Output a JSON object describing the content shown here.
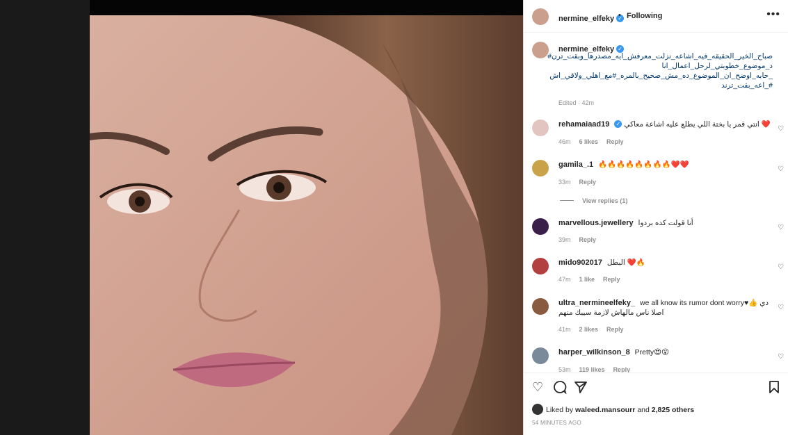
{
  "post": {
    "username": "nermine_elfeky",
    "separator": "•",
    "following_label": "Following",
    "more_label": "•••",
    "caption": "صباح_الخير_الحقيقه_فيه_اشاعه_نزلت_معرفش_ايه_مصدرها_وبقت_ترن#\nد_موضوع_خطوبتي_لرحل_اعمال_انا\n_حابه_اوضح_ان_الموضوع_ده_مش_صحيح_بالمره_#مع_اهلي_ولاقي_اش\n#_اعه_بقت_ترند",
    "caption_meta": "Edited · 42m"
  },
  "comments": [
    {
      "username": "rehamaiaad19",
      "verified": true,
      "text": "انتي قمر يا بختة اللي يطلع عليه اشاعة معاكي ❤️",
      "time": "46m",
      "likes": "6 likes",
      "reply": "Reply"
    },
    {
      "username": "gamila_.1",
      "verified": false,
      "text": "🔥🔥🔥🔥🔥🔥🔥🔥❤️❤️",
      "time": "33m",
      "likes": "",
      "reply": "Reply"
    },
    {
      "username": "marvellous.jewellery",
      "verified": false,
      "text": "أنا قولت كده بردوا",
      "time": "39m",
      "likes": "",
      "reply": "Reply"
    },
    {
      "username": "mido902017",
      "verified": false,
      "text": "البطل ❤️🔥",
      "time": "47m",
      "likes": "1 like",
      "reply": "Reply"
    },
    {
      "username": "ultra_nermineelfeky_",
      "verified": false,
      "text": "we all know its rumor dont worry♥👍 دي\nاصلا ناس مالهاش لازمة سيبك منهم",
      "time": "41m",
      "likes": "2 likes",
      "reply": "Reply"
    },
    {
      "username": "harper_wilkinson_8",
      "verified": false,
      "text": "Pretty😍😮",
      "time": "53m",
      "likes": "119 likes",
      "reply": "Reply"
    }
  ],
  "view_replies": "View replies (1)",
  "likes": {
    "prefix": "Liked by",
    "user": "waleed.mansourr",
    "middle": "and",
    "others": "2,825 others"
  },
  "timestamp": "54 MINUTES AGO",
  "colors": {
    "link": "#00376b",
    "verified": "#3897f0",
    "muted": "#8e8e8e"
  },
  "icons": {
    "like": "heart-icon",
    "comment": "comment-icon",
    "share": "paper-plane-icon",
    "save": "bookmark-icon"
  }
}
